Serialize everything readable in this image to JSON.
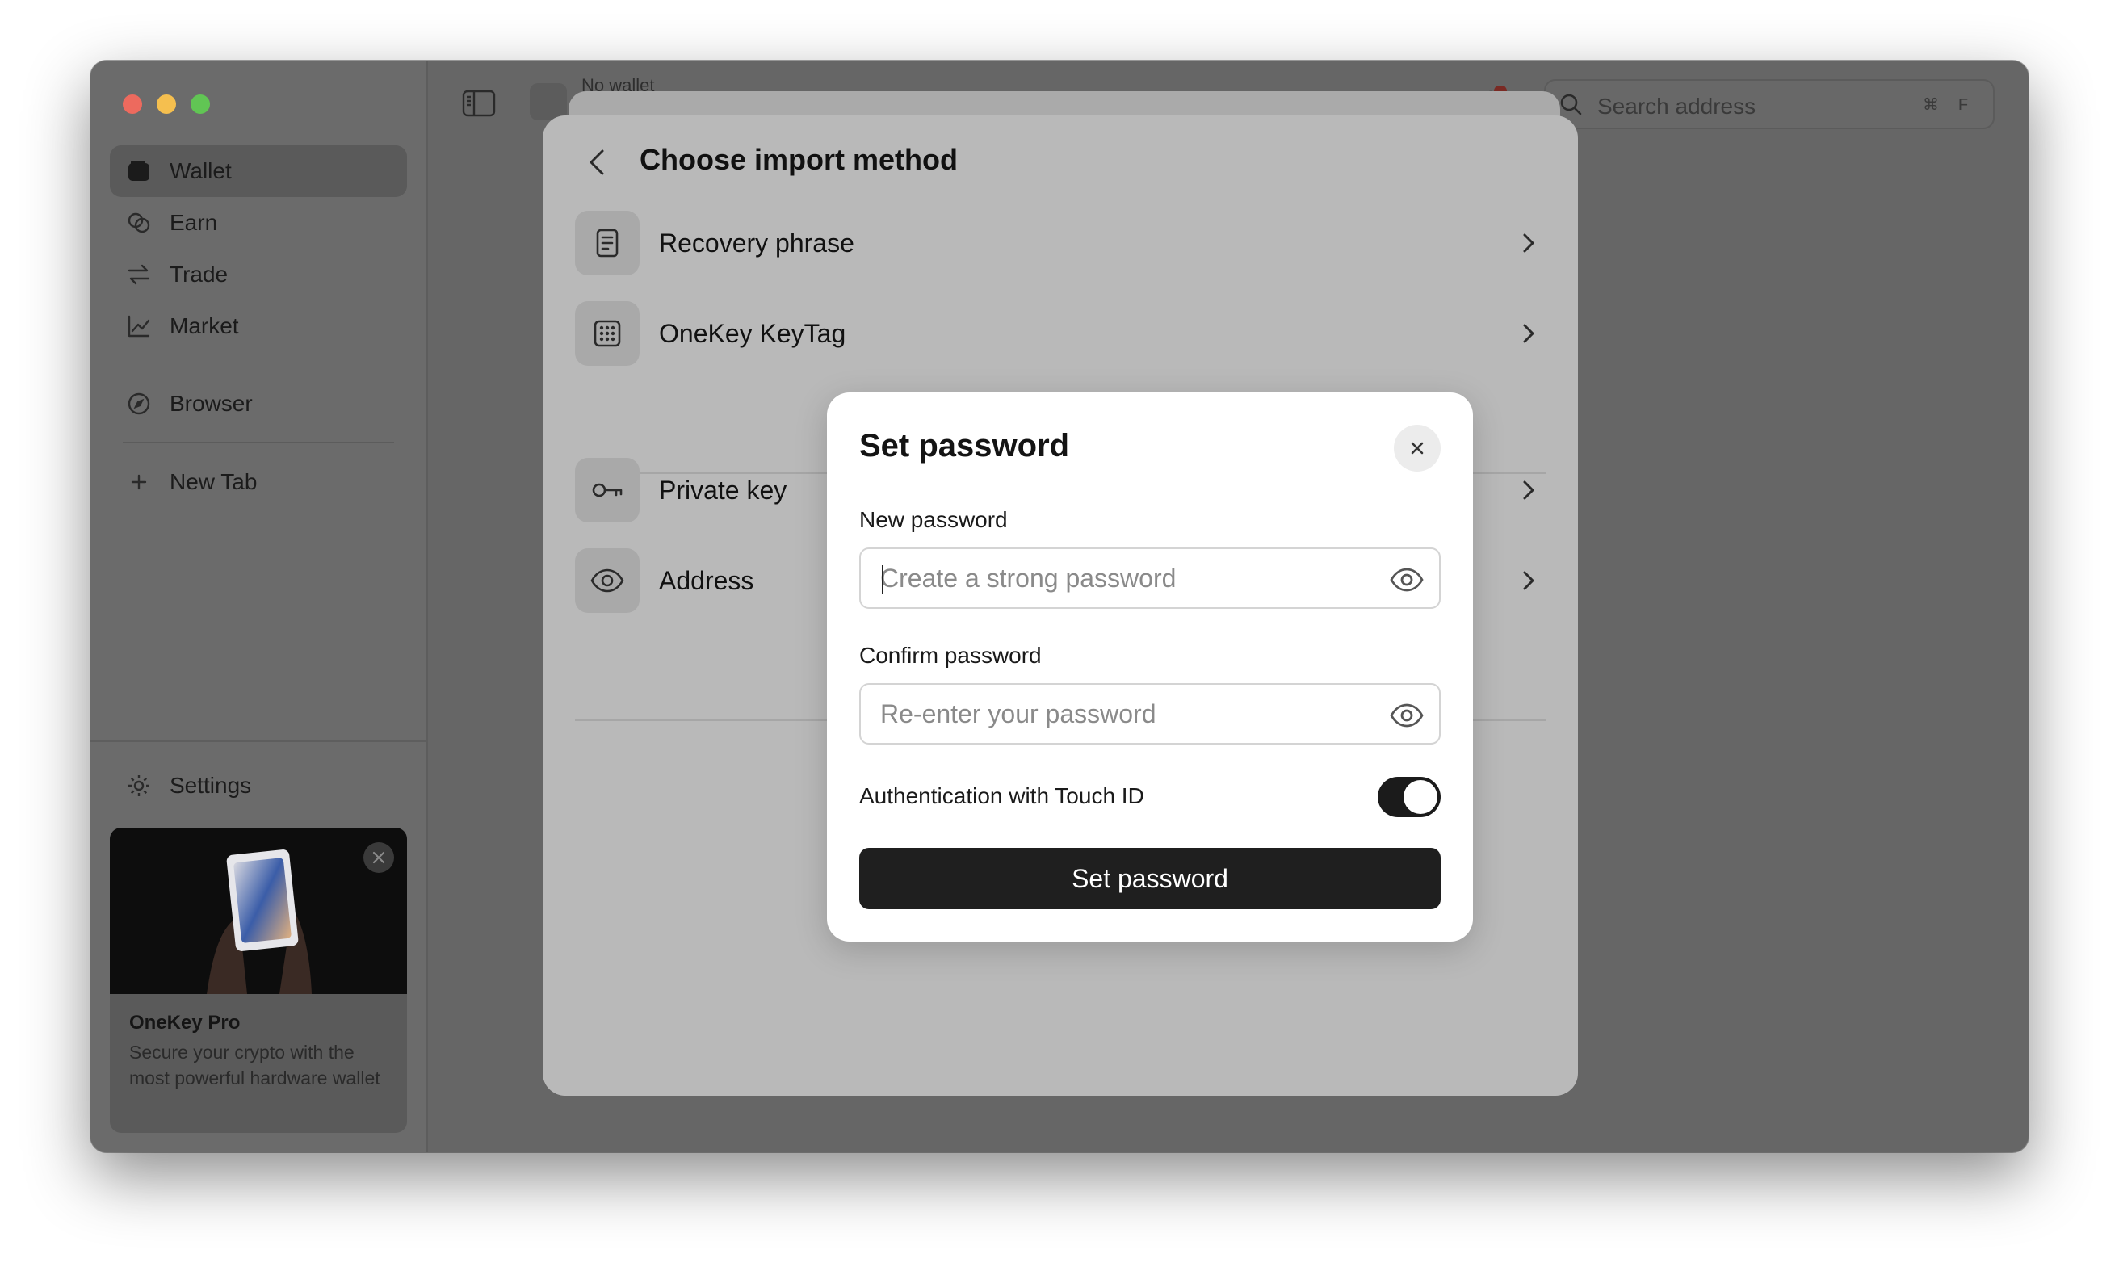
{
  "sidebar": {
    "nav": [
      {
        "label": "Wallet",
        "icon": "wallet-icon",
        "active": true
      },
      {
        "label": "Earn",
        "icon": "earn-icon"
      },
      {
        "label": "Trade",
        "icon": "swap-icon"
      },
      {
        "label": "Market",
        "icon": "chart-icon"
      },
      {
        "label": "Browser",
        "icon": "compass-icon"
      }
    ],
    "new_tab": "New Tab",
    "settings": "Settings",
    "promo": {
      "title": "OneKey Pro",
      "description": "Secure your crypto with the most powerful hardware wallet"
    }
  },
  "topbar": {
    "wallet_label": "No wallet",
    "search_placeholder": "Search address",
    "shortcut_keys": [
      "⌘",
      "F"
    ]
  },
  "import_sheet": {
    "title": "Choose import method",
    "options": [
      {
        "label": "Recovery phrase",
        "icon": "document-icon"
      },
      {
        "label": "OneKey KeyTag",
        "icon": "grid-icon"
      },
      {
        "label": "Private key",
        "icon": "key-icon"
      },
      {
        "label": "Address",
        "icon": "eye-icon"
      }
    ]
  },
  "dialog": {
    "title": "Set password",
    "new_password_label": "New password",
    "new_password_placeholder": "Create a strong password",
    "confirm_password_label": "Confirm password",
    "confirm_password_placeholder": "Re-enter your password",
    "touch_id_label": "Authentication with Touch ID",
    "touch_id_enabled": true,
    "submit_label": "Set password"
  },
  "colors": {
    "overlay_window": "#666666",
    "dialog_bg": "#ffffff",
    "primary_button": "#1f1f1f"
  }
}
